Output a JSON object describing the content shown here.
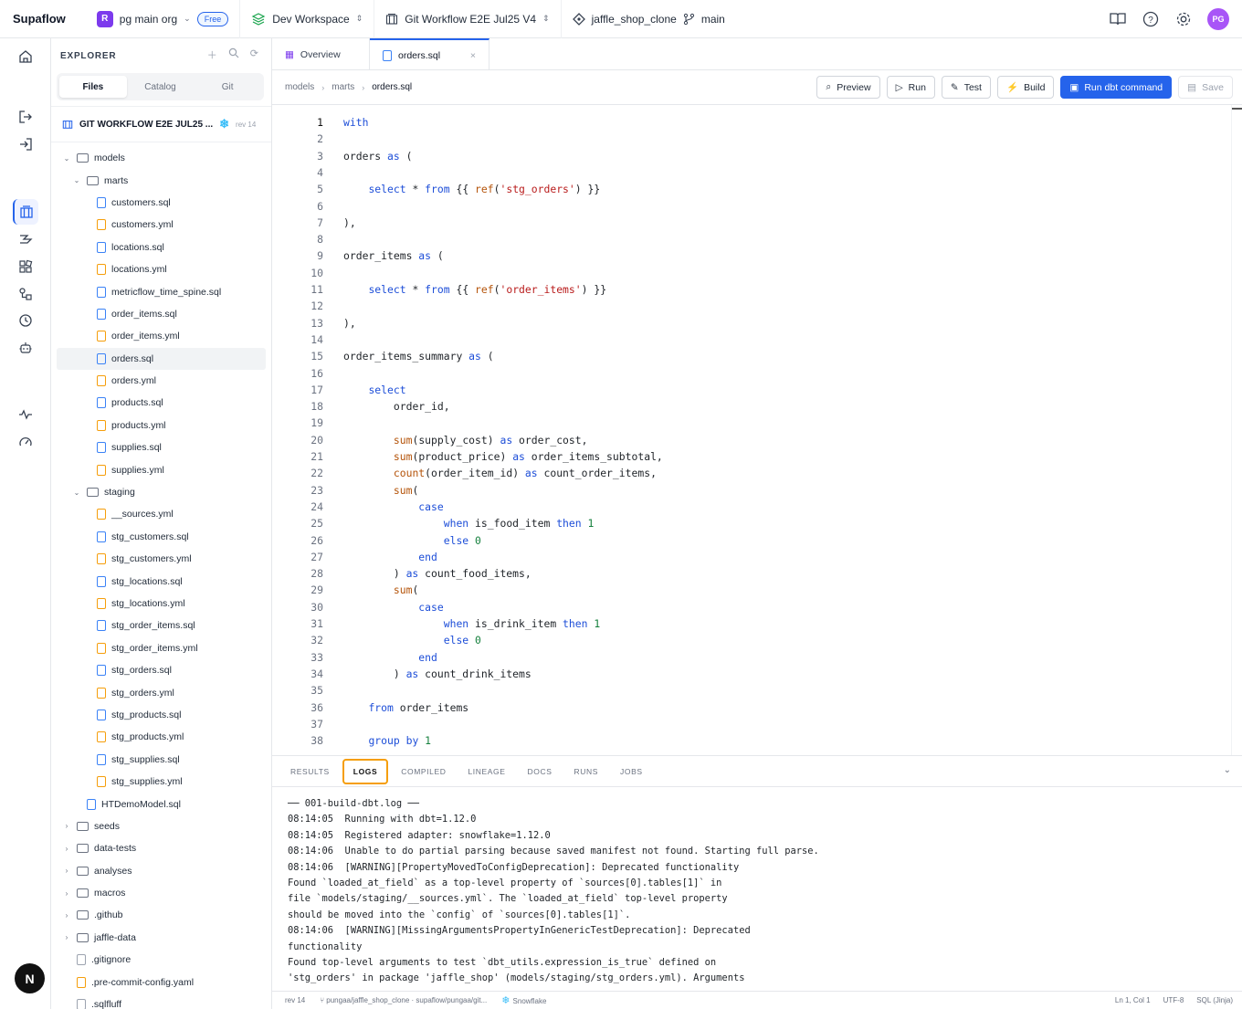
{
  "topbar": {
    "brand": "Supaflow",
    "org": "pg main org",
    "org_initial": "R",
    "plan": "Free",
    "workspace": "Dev Workspace",
    "project": "Git Workflow E2E Jul25 V4",
    "repo": "jaffle_shop_clone",
    "branch": "main",
    "user_initials": "PG",
    "icons": [
      "book-icon",
      "help-icon",
      "gear-icon"
    ]
  },
  "explorer": {
    "title": "EXPLORER",
    "tabs": [
      "Files",
      "Catalog",
      "Git"
    ],
    "project_name": "GIT WORKFLOW E2E JUL25 ...",
    "project_rev": "rev 14",
    "tree": [
      {
        "label": "models",
        "type": "folder",
        "depth": 0,
        "open": true
      },
      {
        "label": "marts",
        "type": "folder",
        "depth": 1,
        "open": true
      },
      {
        "label": "customers.sql",
        "type": "sql",
        "depth": 2
      },
      {
        "label": "customers.yml",
        "type": "yml",
        "depth": 2
      },
      {
        "label": "locations.sql",
        "type": "sql",
        "depth": 2
      },
      {
        "label": "locations.yml",
        "type": "yml",
        "depth": 2
      },
      {
        "label": "metricflow_time_spine.sql",
        "type": "sql",
        "depth": 2
      },
      {
        "label": "order_items.sql",
        "type": "sql",
        "depth": 2
      },
      {
        "label": "order_items.yml",
        "type": "yml",
        "depth": 2
      },
      {
        "label": "orders.sql",
        "type": "sql",
        "depth": 2,
        "selected": true
      },
      {
        "label": "orders.yml",
        "type": "yml",
        "depth": 2
      },
      {
        "label": "products.sql",
        "type": "sql",
        "depth": 2
      },
      {
        "label": "products.yml",
        "type": "yml",
        "depth": 2
      },
      {
        "label": "supplies.sql",
        "type": "sql",
        "depth": 2
      },
      {
        "label": "supplies.yml",
        "type": "yml",
        "depth": 2
      },
      {
        "label": "staging",
        "type": "folder",
        "depth": 1,
        "open": true
      },
      {
        "label": "__sources.yml",
        "type": "yml",
        "depth": 2
      },
      {
        "label": "stg_customers.sql",
        "type": "sql",
        "depth": 2
      },
      {
        "label": "stg_customers.yml",
        "type": "yml",
        "depth": 2
      },
      {
        "label": "stg_locations.sql",
        "type": "sql",
        "depth": 2
      },
      {
        "label": "stg_locations.yml",
        "type": "yml",
        "depth": 2
      },
      {
        "label": "stg_order_items.sql",
        "type": "sql",
        "depth": 2
      },
      {
        "label": "stg_order_items.yml",
        "type": "yml",
        "depth": 2
      },
      {
        "label": "stg_orders.sql",
        "type": "sql",
        "depth": 2
      },
      {
        "label": "stg_orders.yml",
        "type": "yml",
        "depth": 2
      },
      {
        "label": "stg_products.sql",
        "type": "sql",
        "depth": 2
      },
      {
        "label": "stg_products.yml",
        "type": "yml",
        "depth": 2
      },
      {
        "label": "stg_supplies.sql",
        "type": "sql",
        "depth": 2
      },
      {
        "label": "stg_supplies.yml",
        "type": "yml",
        "depth": 2
      },
      {
        "label": "HTDemoModel.sql",
        "type": "sql",
        "depth": 1
      },
      {
        "label": "seeds",
        "type": "folder",
        "depth": 0,
        "open": false
      },
      {
        "label": "data-tests",
        "type": "folder",
        "depth": 0,
        "open": false
      },
      {
        "label": "analyses",
        "type": "folder",
        "depth": 0,
        "open": false
      },
      {
        "label": "macros",
        "type": "folder",
        "depth": 0,
        "open": false
      },
      {
        "label": ".github",
        "type": "folder",
        "depth": 0,
        "open": false
      },
      {
        "label": "jaffle-data",
        "type": "folder",
        "depth": 0,
        "open": false
      },
      {
        "label": ".gitignore",
        "type": "txt",
        "depth": 0
      },
      {
        "label": ".pre-commit-config.yaml",
        "type": "yml",
        "depth": 0
      },
      {
        "label": ".sqlfluff",
        "type": "txt",
        "depth": 0
      }
    ]
  },
  "tabs": [
    {
      "label": "Overview",
      "active": false
    },
    {
      "label": "orders.sql",
      "active": true
    }
  ],
  "breadcrumb": [
    "models",
    "marts",
    "orders.sql"
  ],
  "toolbar": {
    "preview": "Preview",
    "run": "Run",
    "test": "Test",
    "build": "Build",
    "run_cmd": "Run dbt command",
    "save": "Save"
  },
  "code_lines": [
    "with",
    "",
    "orders as (",
    "",
    "    select * from {{ ref('stg_orders') }}",
    "",
    "),",
    "",
    "order_items as (",
    "",
    "    select * from {{ ref('order_items') }}",
    "",
    "),",
    "",
    "order_items_summary as (",
    "",
    "    select",
    "        order_id,",
    "",
    "        sum(supply_cost) as order_cost,",
    "        sum(product_price) as order_items_subtotal,",
    "        count(order_item_id) as count_order_items,",
    "        sum(",
    "            case",
    "                when is_food_item then 1",
    "                else 0",
    "            end",
    "        ) as count_food_items,",
    "        sum(",
    "            case",
    "                when is_drink_item then 1",
    "                else 0",
    "            end",
    "        ) as count_drink_items",
    "",
    "    from order_items",
    "",
    "    group by 1"
  ],
  "panel": {
    "tabs": [
      "RESULTS",
      "LOGS",
      "COMPILED",
      "LINEAGE",
      "DOCS",
      "RUNS",
      "JOBS"
    ],
    "active_tab": "LOGS",
    "logs": [
      "── 001-build-dbt.log ──",
      "08:14:05  Running with dbt=1.12.0",
      "08:14:05  Registered adapter: snowflake=1.12.0",
      "08:14:06  Unable to do partial parsing because saved manifest not found. Starting full parse.",
      "08:14:06  [WARNING][PropertyMovedToConfigDeprecation]: Deprecated functionality",
      "Found `loaded_at_field` as a top-level property of `sources[0].tables[1]` in",
      "file `models/staging/__sources.yml`. The `loaded_at_field` top-level property",
      "should be moved into the `config` of `sources[0].tables[1]`.",
      "08:14:06  [WARNING][MissingArgumentsPropertyInGenericTestDeprecation]: Deprecated",
      "functionality",
      "Found top-level arguments to test `dbt_utils.expression_is_true` defined on",
      "'stg_orders' in package 'jaffle_shop' (models/staging/stg_orders.yml). Arguments"
    ]
  },
  "status": {
    "rev": "rev 14",
    "branch_path": "pungaa/jaffle_shop_clone · supaflow/pungaa/git...",
    "warehouse": "Snowflake",
    "cursor": "Ln 1, Col 1",
    "encoding": "UTF-8",
    "language": "SQL (Jinja)"
  }
}
